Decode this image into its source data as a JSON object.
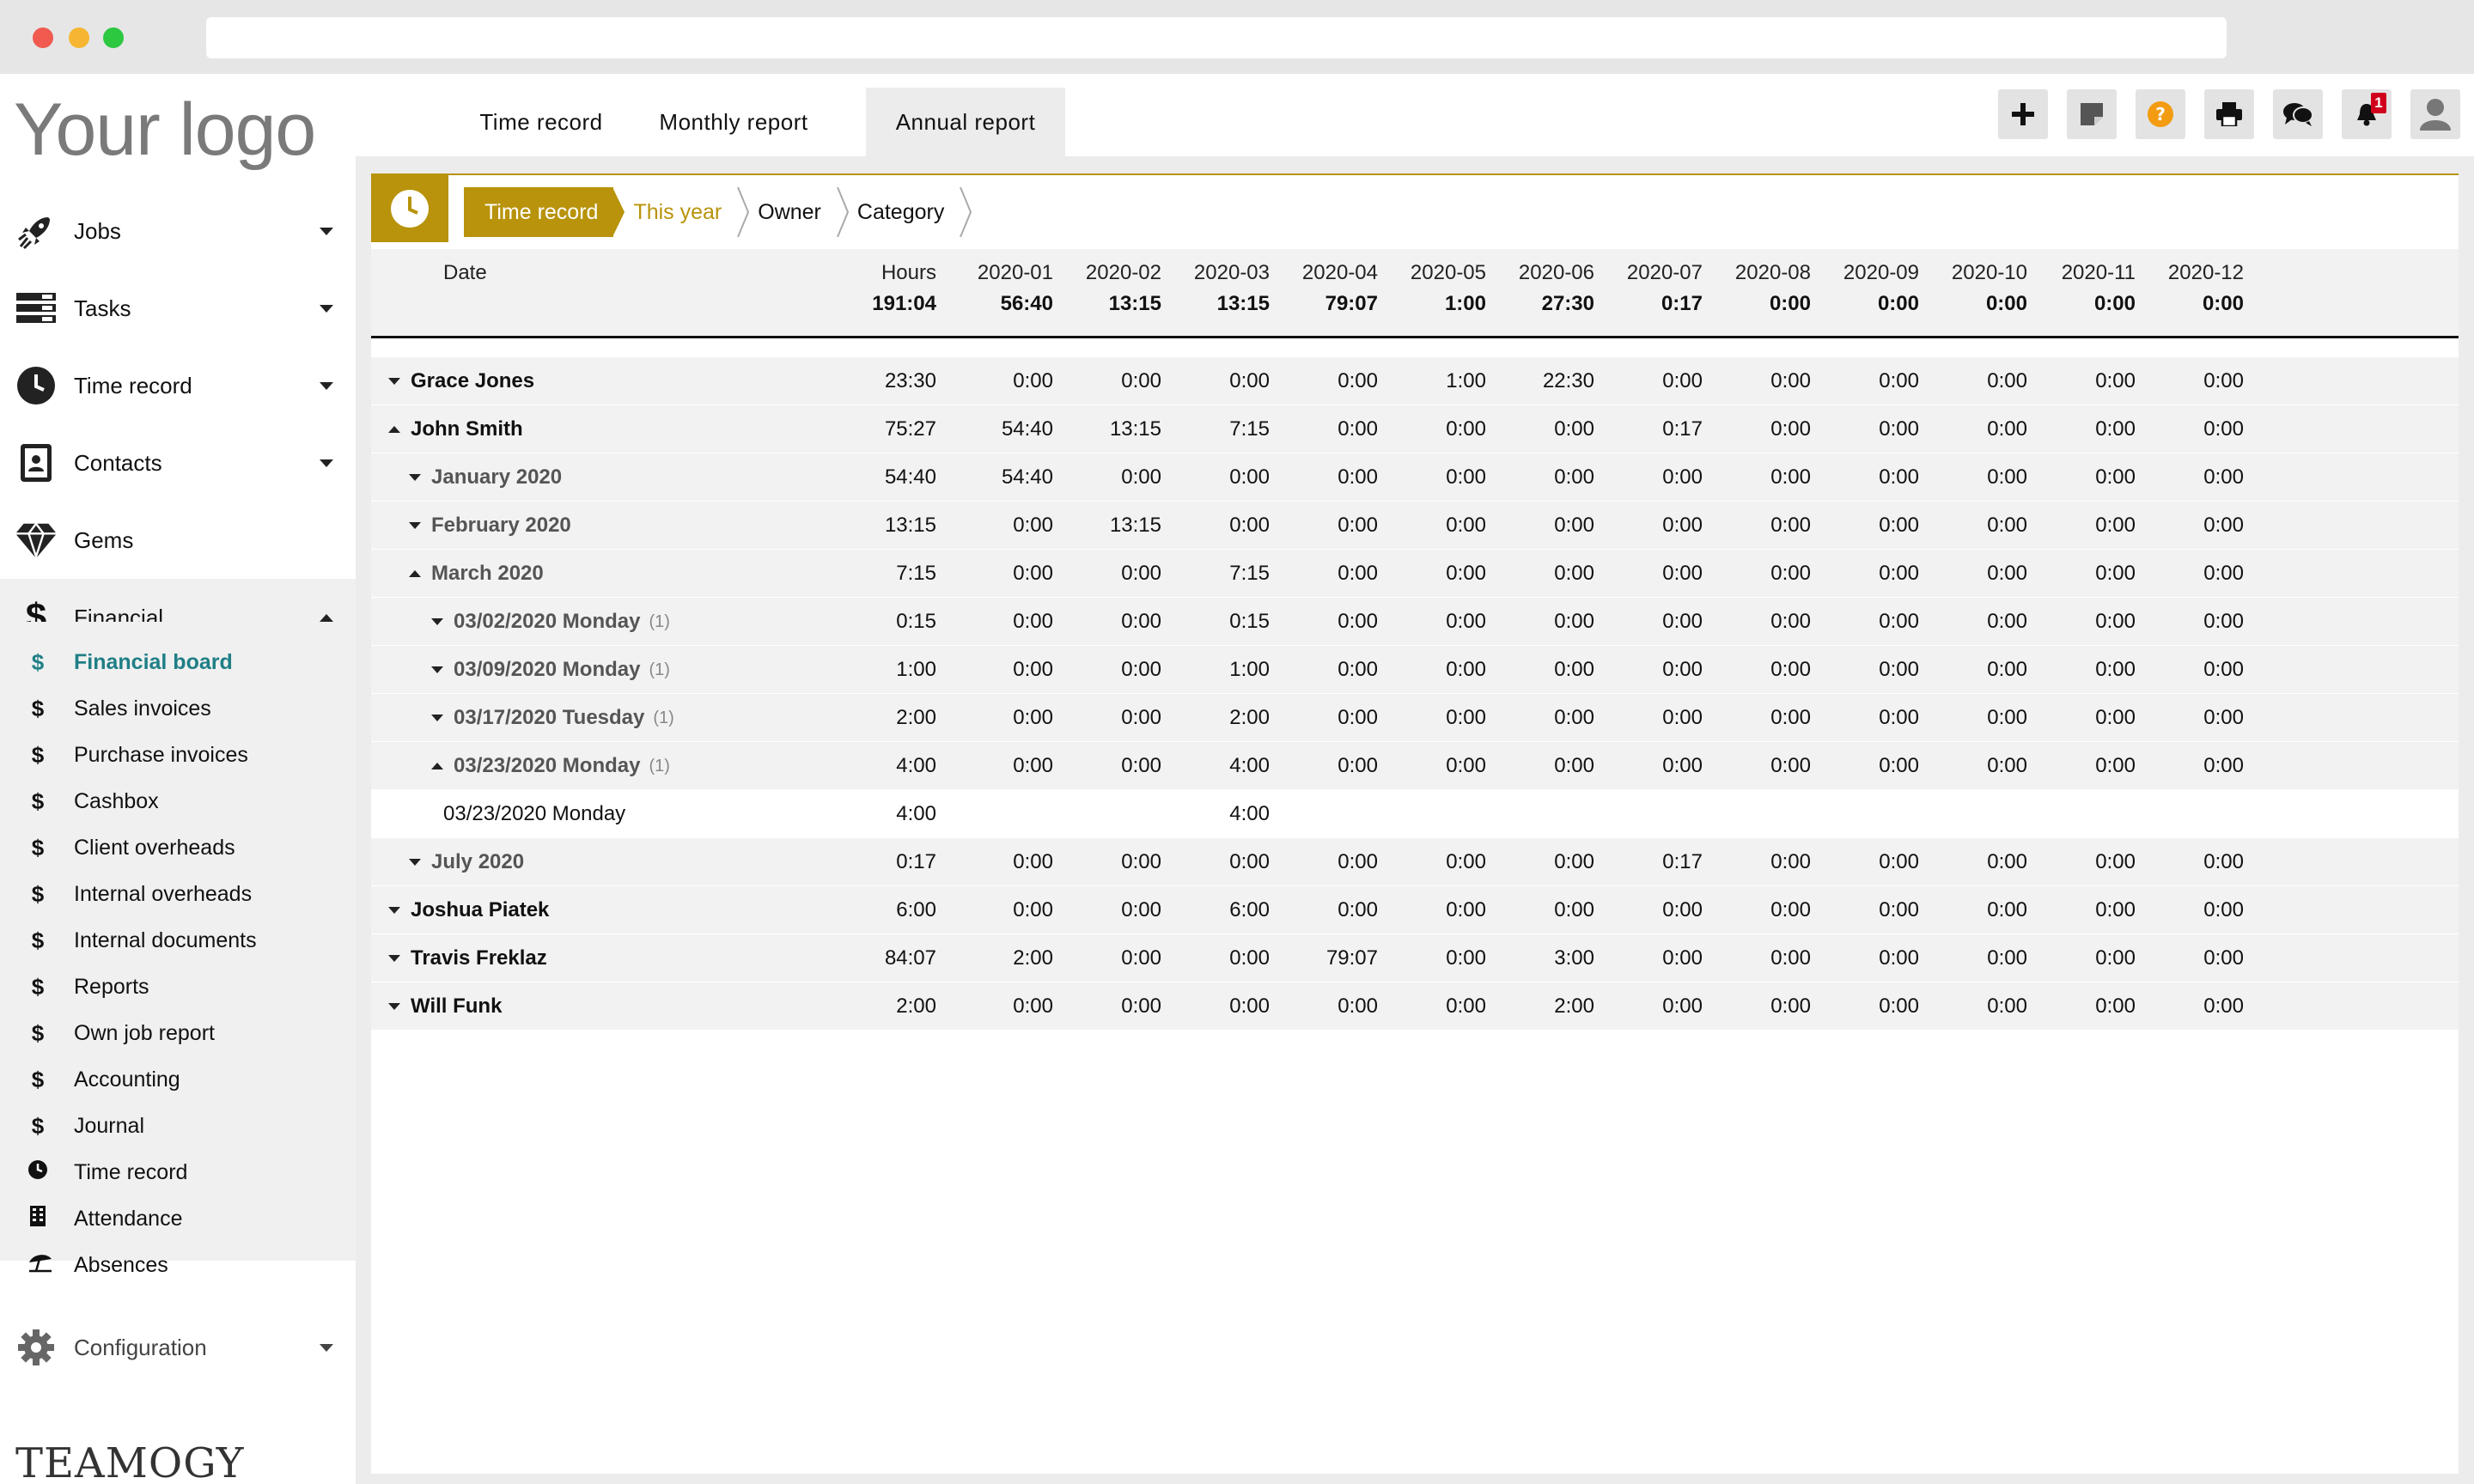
{
  "sidebar": {
    "logo": "Your logo",
    "items": [
      {
        "label": "Jobs",
        "icon": "rocket-icon"
      },
      {
        "label": "Tasks",
        "icon": "tasks-icon"
      },
      {
        "label": "Time record",
        "icon": "clock-icon"
      },
      {
        "label": "Contacts",
        "icon": "contacts-icon"
      },
      {
        "label": "Gems",
        "icon": "gem-icon"
      },
      {
        "label": "Financial",
        "icon": "dollar-icon"
      }
    ],
    "sub_items": [
      {
        "label": "Financial board",
        "icon": "$"
      },
      {
        "label": "Sales invoices",
        "icon": "$"
      },
      {
        "label": "Purchase invoices",
        "icon": "$"
      },
      {
        "label": "Cashbox",
        "icon": "$"
      },
      {
        "label": "Client overheads",
        "icon": "$"
      },
      {
        "label": "Internal overheads",
        "icon": "$"
      },
      {
        "label": "Internal documents",
        "icon": "$"
      },
      {
        "label": "Reports",
        "icon": "$"
      },
      {
        "label": "Own job report",
        "icon": "$"
      },
      {
        "label": "Accounting",
        "icon": "$"
      },
      {
        "label": "Journal",
        "icon": "$"
      },
      {
        "label": "Time record",
        "icon": "clock-icon"
      },
      {
        "label": "Attendance",
        "icon": "building-icon"
      },
      {
        "label": "Absences",
        "icon": "umbrella-icon"
      }
    ],
    "config_label": "Configuration",
    "brand": "TEAMOGY"
  },
  "tabs": [
    "Time record",
    "Monthly report",
    "Annual report"
  ],
  "notifications_count": "1",
  "breadcrumbs": [
    "Time record",
    "This year",
    "Owner",
    "Category"
  ],
  "table": {
    "date_header": "Date",
    "columns": [
      "Hours",
      "2020-01",
      "2020-02",
      "2020-03",
      "2020-04",
      "2020-05",
      "2020-06",
      "2020-07",
      "2020-08",
      "2020-09",
      "2020-10",
      "2020-11",
      "2020-12"
    ],
    "totals": [
      "191:04",
      "56:40",
      "13:15",
      "13:15",
      "79:07",
      "1:00",
      "27:30",
      "0:17",
      "0:00",
      "0:00",
      "0:00",
      "0:00",
      "0:00"
    ],
    "rows": [
      {
        "name": "Grace Jones",
        "values": [
          "23:30",
          "0:00",
          "0:00",
          "0:00",
          "0:00",
          "1:00",
          "22:30",
          "0:00",
          "0:00",
          "0:00",
          "0:00",
          "0:00",
          "0:00"
        ]
      },
      {
        "name": "John Smith",
        "values": [
          "75:27",
          "54:40",
          "13:15",
          "7:15",
          "0:00",
          "0:00",
          "0:00",
          "0:17",
          "0:00",
          "0:00",
          "0:00",
          "0:00",
          "0:00"
        ]
      },
      {
        "name": "January 2020",
        "values": [
          "54:40",
          "54:40",
          "0:00",
          "0:00",
          "0:00",
          "0:00",
          "0:00",
          "0:00",
          "0:00",
          "0:00",
          "0:00",
          "0:00",
          "0:00"
        ]
      },
      {
        "name": "February 2020",
        "values": [
          "13:15",
          "0:00",
          "13:15",
          "0:00",
          "0:00",
          "0:00",
          "0:00",
          "0:00",
          "0:00",
          "0:00",
          "0:00",
          "0:00",
          "0:00"
        ]
      },
      {
        "name": "March 2020",
        "values": [
          "7:15",
          "0:00",
          "0:00",
          "7:15",
          "0:00",
          "0:00",
          "0:00",
          "0:00",
          "0:00",
          "0:00",
          "0:00",
          "0:00",
          "0:00"
        ]
      },
      {
        "name": "03/02/2020 Monday",
        "count": "(1)",
        "values": [
          "0:15",
          "0:00",
          "0:00",
          "0:15",
          "0:00",
          "0:00",
          "0:00",
          "0:00",
          "0:00",
          "0:00",
          "0:00",
          "0:00",
          "0:00"
        ]
      },
      {
        "name": "03/09/2020 Monday",
        "count": "(1)",
        "values": [
          "1:00",
          "0:00",
          "0:00",
          "1:00",
          "0:00",
          "0:00",
          "0:00",
          "0:00",
          "0:00",
          "0:00",
          "0:00",
          "0:00",
          "0:00"
        ]
      },
      {
        "name": "03/17/2020 Tuesday",
        "count": "(1)",
        "values": [
          "2:00",
          "0:00",
          "0:00",
          "2:00",
          "0:00",
          "0:00",
          "0:00",
          "0:00",
          "0:00",
          "0:00",
          "0:00",
          "0:00",
          "0:00"
        ]
      },
      {
        "name": "03/23/2020 Monday",
        "count": "(1)",
        "values": [
          "4:00",
          "0:00",
          "0:00",
          "4:00",
          "0:00",
          "0:00",
          "0:00",
          "0:00",
          "0:00",
          "0:00",
          "0:00",
          "0:00",
          "0:00"
        ]
      },
      {
        "name": "03/23/2020 Monday",
        "values": [
          "4:00",
          "",
          "",
          "4:00",
          "",
          "",
          "",
          "",
          "",
          "",
          "",
          "",
          ""
        ]
      },
      {
        "name": "July 2020",
        "values": [
          "0:17",
          "0:00",
          "0:00",
          "0:00",
          "0:00",
          "0:00",
          "0:00",
          "0:17",
          "0:00",
          "0:00",
          "0:00",
          "0:00",
          "0:00"
        ]
      },
      {
        "name": "Joshua Piatek",
        "values": [
          "6:00",
          "0:00",
          "0:00",
          "6:00",
          "0:00",
          "0:00",
          "0:00",
          "0:00",
          "0:00",
          "0:00",
          "0:00",
          "0:00",
          "0:00"
        ]
      },
      {
        "name": "Travis Freklaz",
        "values": [
          "84:07",
          "2:00",
          "0:00",
          "0:00",
          "79:07",
          "0:00",
          "3:00",
          "0:00",
          "0:00",
          "0:00",
          "0:00",
          "0:00",
          "0:00"
        ]
      },
      {
        "name": "Will Funk",
        "values": [
          "2:00",
          "0:00",
          "0:00",
          "0:00",
          "0:00",
          "0:00",
          "2:00",
          "0:00",
          "0:00",
          "0:00",
          "0:00",
          "0:00",
          "0:00"
        ]
      }
    ]
  },
  "colors": {
    "accent": "#b8930b",
    "active_link": "#1f7f86",
    "badge": "#d0021b",
    "help": "#f39c12"
  }
}
